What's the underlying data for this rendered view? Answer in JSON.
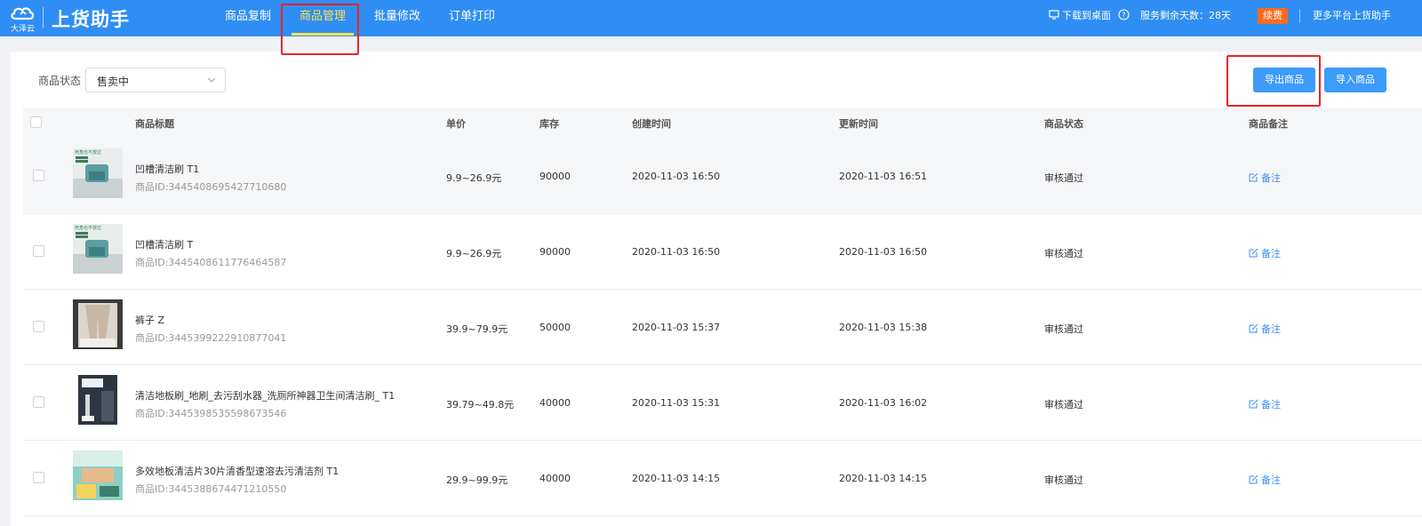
{
  "header": {
    "logo_text": "大泽云",
    "app_name": "上货助手",
    "nav": [
      {
        "label": "商品复制"
      },
      {
        "label": "商品管理"
      },
      {
        "label": "批量修改"
      },
      {
        "label": "订单打印"
      }
    ],
    "download_label": "下载到桌面",
    "service_days": "服务剩余天数：28天",
    "renew_label": "续费",
    "more_platforms": "更多平台上货助手"
  },
  "filter": {
    "label": "商品状态",
    "selected": "售卖中"
  },
  "actions": {
    "export_label": "导出商品",
    "import_label": "导入商品"
  },
  "table": {
    "columns": [
      "商品标题",
      "单价",
      "库存",
      "创建时间",
      "更新时间",
      "商品状态",
      "商品备注"
    ],
    "note_label": "备注",
    "rows": [
      {
        "title": "凹槽清洁刷 T1",
        "id": "商品ID:3445408695427710680",
        "price": "9.9~26.9元",
        "stock": "90000",
        "created": "2020-11-03 16:50",
        "updated": "2020-11-03 16:51",
        "status": "审核通过",
        "thumb_text": "死角也不放过"
      },
      {
        "title": "凹槽清洁刷 T",
        "id": "商品ID:3445408611776464587",
        "price": "9.9~26.9元",
        "stock": "90000",
        "created": "2020-11-03 16:50",
        "updated": "2020-11-03 16:50",
        "status": "审核通过",
        "thumb_text": "死角也不放过"
      },
      {
        "title": "裤子 Z",
        "id": "商品ID:3445399222910877041",
        "price": "39.9~79.9元",
        "stock": "50000",
        "created": "2020-11-03 15:37",
        "updated": "2020-11-03 15:38",
        "status": "审核通过",
        "thumb_text": ""
      },
      {
        "title": "清洁地板刷_地刷_去污刮水器_洗厕所神器卫生间清洁刷_ T1",
        "id": "商品ID:3445398535598673546",
        "price": "39.79~49.8元",
        "stock": "40000",
        "created": "2020-11-03 15:31",
        "updated": "2020-11-03 16:02",
        "status": "审核通过",
        "thumb_text": ""
      },
      {
        "title": "多效地板清洁片30片清香型速溶去污清洁剂 T1",
        "id": "商品ID:3445388674471210550",
        "price": "29.9~99.9元",
        "stock": "40000",
        "created": "2020-11-03 14:15",
        "updated": "2020-11-03 14:15",
        "status": "审核通过",
        "thumb_text": ""
      }
    ]
  },
  "colors": {
    "nav_bg": "#2f8ef4",
    "active_nav": "#ffe14d",
    "highlight_box": "#e8242b",
    "renew_badge": "#fa6a1f",
    "button": "#3d9bfa",
    "link": "#3d8ef0"
  }
}
